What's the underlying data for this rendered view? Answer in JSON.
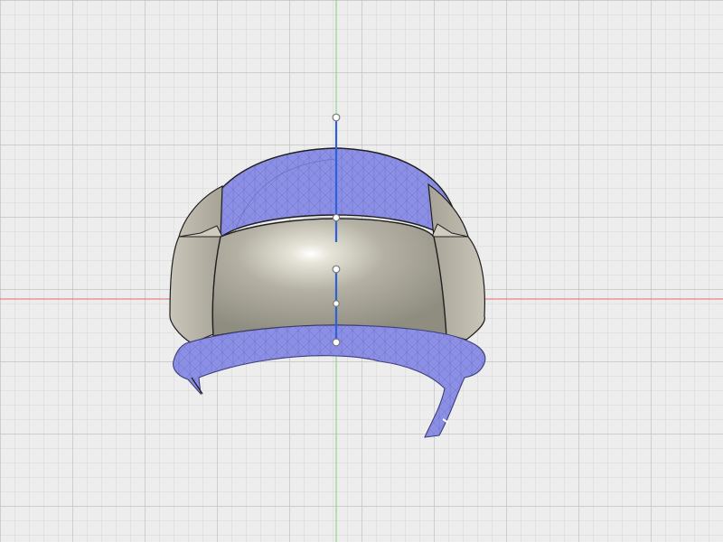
{
  "viewport": {
    "background": "#ededed",
    "grid": {
      "minor_color": "#d6d6d6",
      "major_color": "#b9b9b9"
    },
    "axes": {
      "x_axis_color": "#e46b6b",
      "y_axis_color": "#7fd17f"
    }
  },
  "model": {
    "mesh_color": "#8c8fe6",
    "mesh_edge_color": "#5a5fa8",
    "shell_color": "#b9b6aa",
    "visor_color": "#a7a599",
    "outline_color": "#1f1f1f"
  },
  "manipulator": {
    "line_color": "#2c62d6",
    "handle_fill": "#ffffff",
    "handle_stroke": "#7a7a7a",
    "handles": [
      "top-handle",
      "upper-handle",
      "center-handle",
      "lower-handle",
      "bottom-handle"
    ]
  },
  "icons": [
    "grid-icon",
    "axis-icon",
    "gizmo-icon"
  ]
}
